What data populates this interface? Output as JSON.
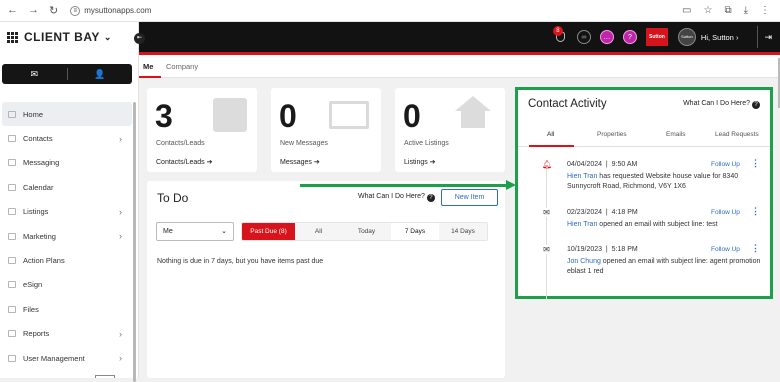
{
  "browser": {
    "url": "mysuttonapps.com"
  },
  "app": {
    "logo": "CLIENT BAY"
  },
  "sidebar": {
    "items": [
      {
        "label": "Home",
        "active": true,
        "arrow": false
      },
      {
        "label": "Contacts",
        "arrow": true
      },
      {
        "label": "Messaging",
        "arrow": false
      },
      {
        "label": "Calendar",
        "arrow": false
      },
      {
        "label": "Listings",
        "arrow": true
      },
      {
        "label": "Marketing",
        "arrow": true
      },
      {
        "label": "Action Plans",
        "arrow": false
      },
      {
        "label": "eSign",
        "arrow": false
      },
      {
        "label": "Files",
        "arrow": false
      },
      {
        "label": "Reports",
        "arrow": true
      },
      {
        "label": "User Management",
        "arrow": true
      }
    ]
  },
  "topbar": {
    "notification_count": "8",
    "brand_badge": "Sutton",
    "avatar_text": "Sutton",
    "greeting": "Hi, Sutton"
  },
  "tabs": {
    "me": "Me",
    "company": "Company"
  },
  "cards": [
    {
      "count": "3",
      "label": "Contacts/Leads",
      "link": "Contacts/Leads ➔"
    },
    {
      "count": "0",
      "label": "New Messages",
      "link": "Messages ➔"
    },
    {
      "count": "0",
      "label": "Active Listings",
      "link": "Listings ➔"
    }
  ],
  "todo": {
    "title": "To Do",
    "what_can_i_do": "What Can I Do Here?",
    "new_item": "New Item",
    "owner_select": "Me",
    "filters": [
      "Past Due (8)",
      "All",
      "Today",
      "7 Days",
      "14 Days"
    ],
    "empty_message": "Nothing is due in 7 days, but you have items past due"
  },
  "contact_activity": {
    "title": "Contact Activity",
    "what_can_i_do": "What Can I Do Here?",
    "tabs": [
      "All",
      "Properties",
      "Emails",
      "Lead Requests"
    ],
    "events": [
      {
        "date": "04/04/2024",
        "time": "9:50 AM",
        "icon": "bell-icon",
        "name": "Hien Tran",
        "text": " has requested Website house value for 8340 Sunnycroft Road, Richmond, V6Y 1X6",
        "action": "Follow Up"
      },
      {
        "date": "02/23/2024",
        "time": "4:18 PM",
        "icon": "email-icon",
        "name": "Hien Tran",
        "text": " opened an email with subject line: test",
        "action": "Follow Up"
      },
      {
        "date": "10/19/2023",
        "time": "5:18 PM",
        "icon": "email-icon",
        "name": "Jon Chung",
        "text": " opened an email with subject line: agent promotion eblast 1 red",
        "action": "Follow Up"
      }
    ]
  },
  "colors": {
    "brand_red": "#d7141b",
    "annotation_green": "#1ca04a",
    "link_blue": "#2e6bc6"
  }
}
